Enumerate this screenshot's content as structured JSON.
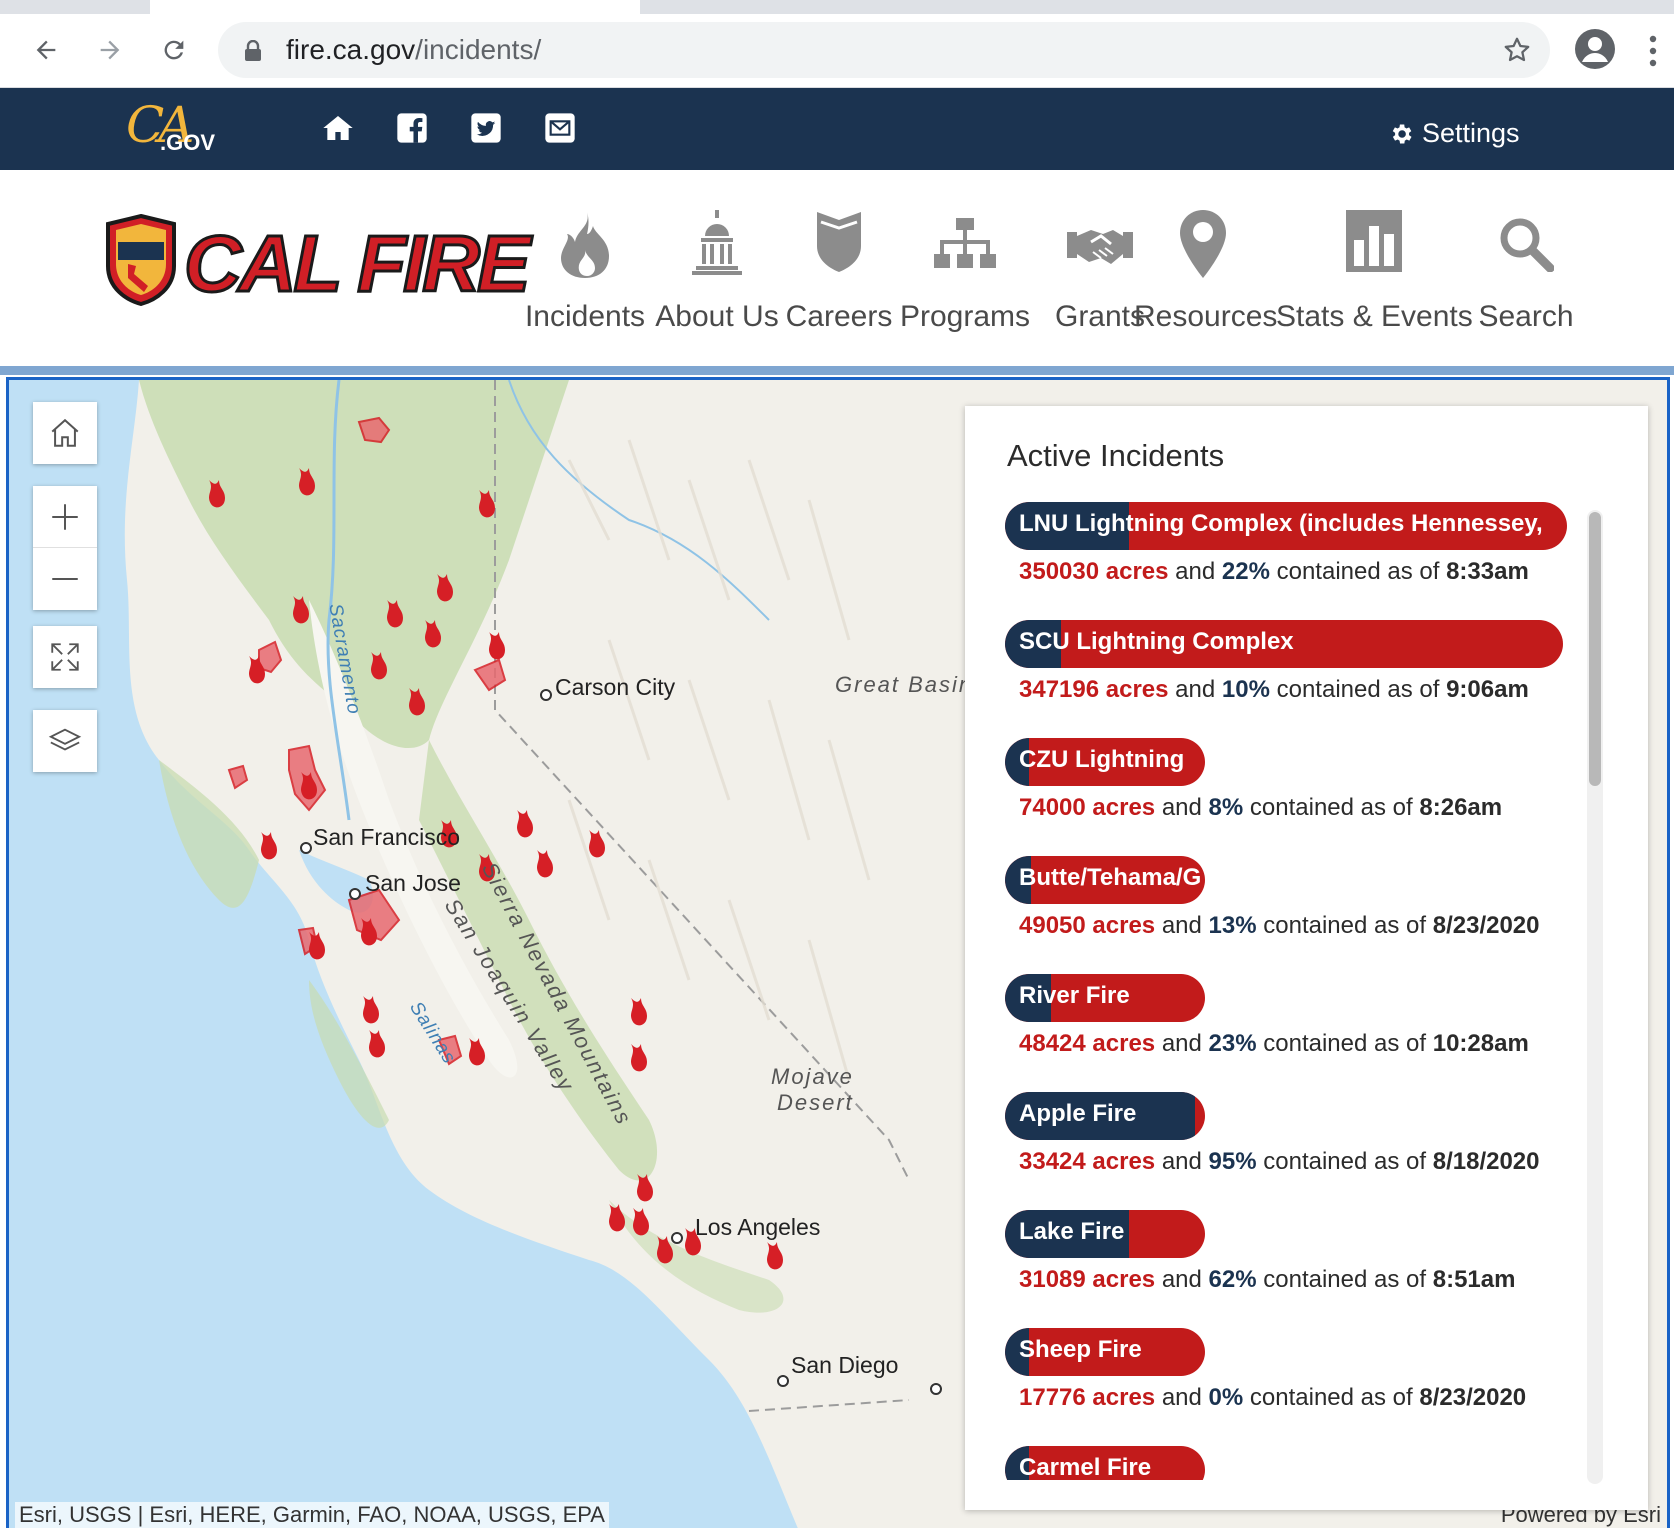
{
  "browser": {
    "url_host": "fire.ca.gov",
    "url_path": "/incidents/"
  },
  "cagov": {
    "logo_ca": "CA",
    "logo_gov": ".GOV",
    "settings_label": "Settings",
    "social_icons": [
      "home-icon",
      "facebook-icon",
      "twitter-icon",
      "email-icon"
    ]
  },
  "header": {
    "logo_text": "CAL FIRE",
    "nav": [
      {
        "label": "Incidents",
        "icon": "flame-icon"
      },
      {
        "label": "About Us",
        "icon": "capitol-icon"
      },
      {
        "label": "Careers",
        "icon": "shield-icon"
      },
      {
        "label": "Programs",
        "icon": "org-chart-icon"
      },
      {
        "label": "Grants",
        "icon": "handshake-icon"
      },
      {
        "label": "Resources",
        "icon": "map-pin-icon"
      },
      {
        "label": "Stats & Events",
        "icon": "bar-chart-icon"
      },
      {
        "label": "Search",
        "icon": "search-icon"
      }
    ]
  },
  "map": {
    "cities": [
      "Carson City",
      "San Francisco",
      "San Jose",
      "Los Angeles",
      "San Diego"
    ],
    "regions": [
      "Great Basin",
      "Mojave",
      "Desert",
      "Sierra Nevada Mountains",
      "San Joaquin Valley"
    ],
    "rivers": [
      "Sacramento",
      "Salinas"
    ],
    "attribution": "Esri, USGS | Esri, HERE, Garmin, FAO, NOAA, USGS, EPA",
    "powered_by": "Powered by Esri",
    "colors": {
      "water": "#bfe0f5",
      "land": "#f2f0ea",
      "forest": "#c8dcb0",
      "fire": "#d61f26"
    }
  },
  "panel": {
    "title": "Active Incidents",
    "word_acres": "acres",
    "word_and": "and",
    "word_contained": "contained as of",
    "incidents": [
      {
        "name": "LNU Lightning Complex (includes Hennessey,",
        "acres": "350030",
        "contained": "22%",
        "contained_fraction": 0.22,
        "as_of": "8:33am"
      },
      {
        "name": "SCU Lightning Complex",
        "acres": "347196",
        "contained": "10%",
        "contained_fraction": 0.1,
        "as_of": "9:06am"
      },
      {
        "name": "CZU Lightning",
        "acres": "74000",
        "contained": "8%",
        "contained_fraction": 0.08,
        "as_of": "8:26am"
      },
      {
        "name": "Butte/Tehama/G",
        "acres": "49050",
        "contained": "13%",
        "contained_fraction": 0.13,
        "as_of": "8/23/2020"
      },
      {
        "name": "River Fire",
        "acres": "48424",
        "contained": "23%",
        "contained_fraction": 0.23,
        "as_of": "10:28am"
      },
      {
        "name": "Apple Fire",
        "acres": "33424",
        "contained": "95%",
        "contained_fraction": 0.95,
        "as_of": "8/18/2020"
      },
      {
        "name": "Lake Fire",
        "acres": "31089",
        "contained": "62%",
        "contained_fraction": 0.62,
        "as_of": "8:51am"
      },
      {
        "name": "Sheep Fire",
        "acres": "17776",
        "contained": "0%",
        "contained_fraction": 0.0,
        "as_of": "8/23/2020"
      },
      {
        "name": "Carmel Fire",
        "acres": "",
        "contained": "",
        "contained_fraction": 0.1,
        "as_of": ""
      }
    ]
  }
}
